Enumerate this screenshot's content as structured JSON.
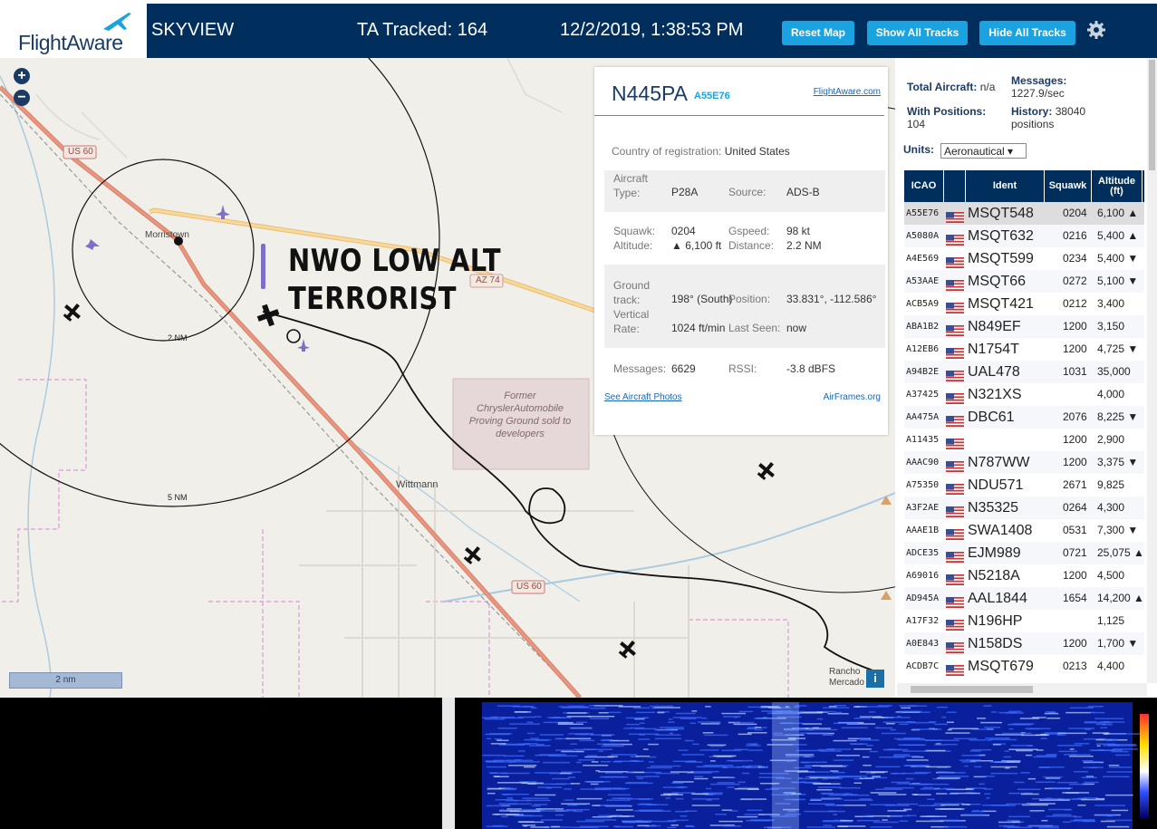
{
  "header": {
    "logo_text": "FlightAware",
    "app_name": "SKYVIEW",
    "tracked": "TA Tracked: 164",
    "datetime": "12/2/2019, 1:38:53 PM",
    "buttons": {
      "reset": "Reset Map",
      "show": "Show All Tracks",
      "hide": "Hide All Tracks"
    }
  },
  "map": {
    "zoom_in": "+",
    "zoom_out": "−",
    "overlay_line1": "NWO LOW ALT",
    "overlay_line2": "TERRORIST",
    "labels": {
      "us60_top": "US 60",
      "us60_bottom": "US 60",
      "az74": "AZ 74",
      "morristown": "Morristown",
      "wittmann": "Wittmann",
      "ring2": "2 NM",
      "ring5": "5 NM",
      "chrysler": "Former ChryslerAutomobile Proving Ground sold to developers",
      "rancho": "Rancho Mercado"
    },
    "scale_label": "2 nm",
    "info_button": "i"
  },
  "popup": {
    "callsign": "N445PA",
    "hex": "A55E76",
    "fa_link": "FlightAware.com",
    "country_label": "Country of registration:",
    "country": "United States",
    "aircraft_type_label": "Aircraft Type:",
    "aircraft_type": "P28A",
    "source_label": "Source:",
    "source": "ADS-B",
    "squawk_label": "Squawk:",
    "squawk": "0204",
    "gspeed_label": "Gspeed:",
    "gspeed": "98 kt",
    "altitude_label": "Altitude:",
    "altitude": "▲ 6,100 ft",
    "distance_label": "Distance:",
    "distance": "2.2 NM",
    "track_label": "Ground track:",
    "track": "198° (South)",
    "position_label": "Position:",
    "position": "33.831°, -112.586°",
    "vrate_label": "Vertical Rate:",
    "vrate": "1024 ft/min",
    "lastseen_label": "Last Seen:",
    "lastseen": "now",
    "messages_label": "Messages:",
    "messages": "6629",
    "rssi_label": "RSSI:",
    "rssi": "-3.8 dBFS",
    "photos_link": "See Aircraft Photos",
    "airframes_link": "AirFrames.org"
  },
  "sidebar": {
    "total_label": "Total Aircraft:",
    "total": "n/a",
    "messages_label": "Messages:",
    "messages": "1227.9/sec",
    "withpos_label": "With Positions:",
    "withpos": "104",
    "history_label": "History:",
    "history": "38040 positions",
    "units_label": "Units:",
    "units_value": "Aeronautical ▾",
    "columns": [
      "ICAO",
      "",
      "Ident",
      "Squawk",
      "Altitude (ft)"
    ],
    "rows": [
      {
        "icao": "A55E76",
        "ident": "MSQT548",
        "squawk": "0204",
        "alt": "6,100 ▲"
      },
      {
        "icao": "A5080A",
        "ident": "MSQT632",
        "squawk": "0216",
        "alt": "5,400 ▲"
      },
      {
        "icao": "A4E569",
        "ident": "MSQT599",
        "squawk": "0234",
        "alt": "5,400 ▼"
      },
      {
        "icao": "A53AAE",
        "ident": "MSQT66",
        "squawk": "0272",
        "alt": "5,100 ▼"
      },
      {
        "icao": "ACB5A9",
        "ident": "MSQT421",
        "squawk": "0212",
        "alt": "3,400"
      },
      {
        "icao": "ABA1B2",
        "ident": "N849EF",
        "squawk": "1200",
        "alt": "3,150"
      },
      {
        "icao": "A12EB6",
        "ident": "N1754T",
        "squawk": "1200",
        "alt": "4,725 ▼"
      },
      {
        "icao": "A94B2E",
        "ident": "UAL478",
        "squawk": "1031",
        "alt": "35,000"
      },
      {
        "icao": "A37425",
        "ident": "N321XS",
        "squawk": "",
        "alt": "4,000"
      },
      {
        "icao": "AA475A",
        "ident": "DBC61",
        "squawk": "2076",
        "alt": "8,225 ▼"
      },
      {
        "icao": "A11435",
        "ident": "",
        "squawk": "1200",
        "alt": "2,900"
      },
      {
        "icao": "AAAC90",
        "ident": "N787WW",
        "squawk": "1200",
        "alt": "3,375 ▼"
      },
      {
        "icao": "A75350",
        "ident": "NDU571",
        "squawk": "2671",
        "alt": "9,825"
      },
      {
        "icao": "A3F2AE",
        "ident": "N35325",
        "squawk": "0264",
        "alt": "4,300"
      },
      {
        "icao": "AAAE1B",
        "ident": "SWA1408",
        "squawk": "0531",
        "alt": "7,300 ▼"
      },
      {
        "icao": "ADCE35",
        "ident": "EJM989",
        "squawk": "0721",
        "alt": "25,075 ▲"
      },
      {
        "icao": "A69016",
        "ident": "N5218A",
        "squawk": "1200",
        "alt": "4,500"
      },
      {
        "icao": "AD945A",
        "ident": "AAL1844",
        "squawk": "1654",
        "alt": "14,200 ▲"
      },
      {
        "icao": "A17F32",
        "ident": "N196HP",
        "squawk": "",
        "alt": "1,125"
      },
      {
        "icao": "A0E843",
        "ident": "N158DS",
        "squawk": "1200",
        "alt": "1,700 ▼"
      },
      {
        "icao": "ACDB7C",
        "ident": "MSQT679",
        "squawk": "0213",
        "alt": "4,400"
      }
    ]
  }
}
